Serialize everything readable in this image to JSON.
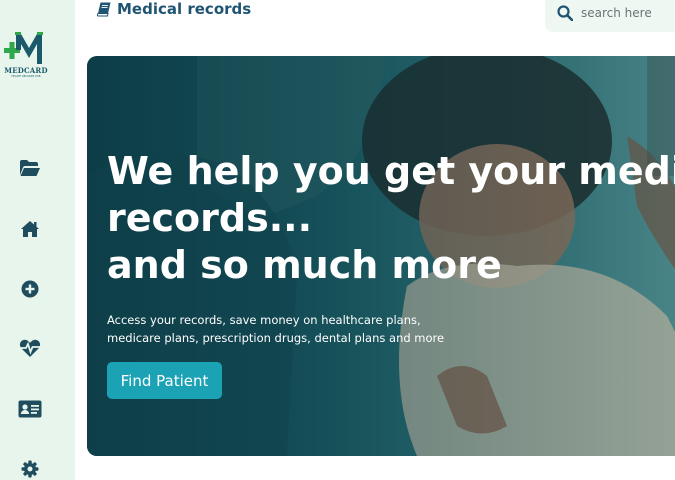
{
  "brand": {
    "logo_letter": "M",
    "logo_name": "MEDCARD",
    "logo_tagline": "HEALTH RECORDS HUB",
    "colors": {
      "green": "#2ea84a",
      "navy": "#1a5a6a"
    }
  },
  "sidebar": {
    "items": [
      {
        "icon": "folder-open-icon",
        "label": "Records"
      },
      {
        "icon": "home-icon",
        "label": "Home"
      },
      {
        "icon": "plus-circle-icon",
        "label": "Add"
      },
      {
        "icon": "heartbeat-icon",
        "label": "Health"
      },
      {
        "icon": "id-card-icon",
        "label": "Patient ID"
      },
      {
        "icon": "gear-icon",
        "label": "Settings"
      }
    ]
  },
  "header": {
    "title": "Medical records",
    "title_icon": "book-icon"
  },
  "search": {
    "icon": "search-icon",
    "placeholder": "search here"
  },
  "hero": {
    "heading_line1": "We help you get your medical",
    "heading_line2": "records...",
    "heading_line3": "and so much more",
    "sub_line1": "Access your records, save money on healthcare plans,",
    "sub_line2": "medicare plans, prescription drugs, dental plans and more",
    "button_label": "Find Patient",
    "colors": {
      "overlay": "#10444f",
      "button": "#1ba3b5"
    }
  }
}
